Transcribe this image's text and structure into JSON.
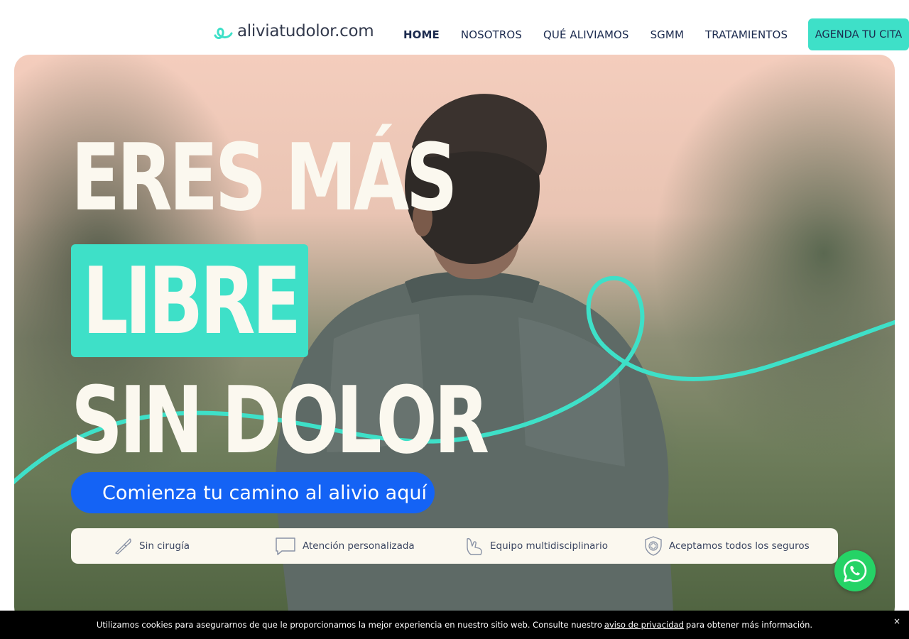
{
  "header": {
    "logo_text": "aliviatudolor.com",
    "nav": [
      {
        "label": "HOME",
        "active": true
      },
      {
        "label": "NOSOTROS"
      },
      {
        "label": "QUÉ ALIVIAMOS"
      },
      {
        "label": "SGMM"
      },
      {
        "label": "TRATAMIENTOS"
      }
    ],
    "cta_label": "AGENDA TU CITA"
  },
  "hero": {
    "line1": "ERES MÁS",
    "line2": "LIBRE",
    "line3": "SIN DOLOR",
    "cta_label": "Comienza tu camino al alivio aquí",
    "features": [
      {
        "icon": "scalpel-icon",
        "label": "Sin cirugía"
      },
      {
        "icon": "chat-bubble-icon",
        "label": "Atención personalizada"
      },
      {
        "icon": "hand-icon",
        "label": "Equipo multidisciplinario"
      },
      {
        "icon": "shield-cross-icon",
        "label": "Aceptamos todos los seguros"
      }
    ]
  },
  "cookie": {
    "text_before": "Utilizamos cookies para asegurarnos de que le proporcionamos la mejor experiencia en nuestro sitio web. Consulte nuestro",
    "link": "aviso de privacidad",
    "text_after": "para obtener más información.",
    "close": "×"
  },
  "colors": {
    "accent": "#3ee0c8",
    "navy": "#1b2a4e",
    "cta_blue": "#1463f5",
    "cream": "#fbf8ef",
    "whatsapp": "#25d366"
  }
}
